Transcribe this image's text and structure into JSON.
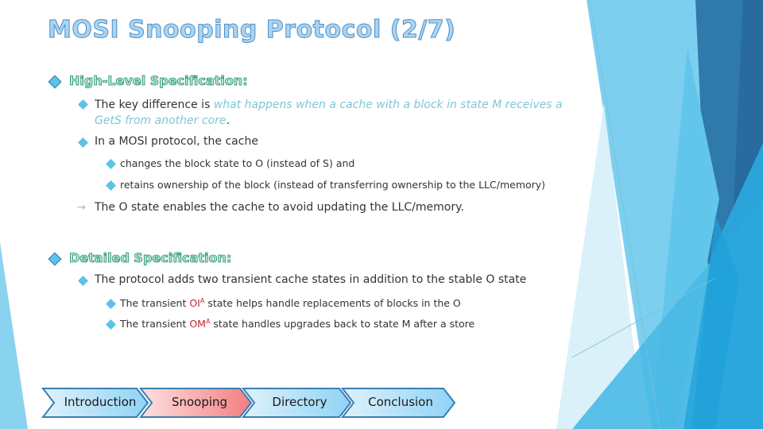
{
  "slide": {
    "title": "MOSI Snooping Protocol (2/7)",
    "accent_colors": {
      "title_fill": "#a9d4f2",
      "section_heading": "#1f8a66",
      "emphasis_text": "#7fc6d6",
      "state_red": "#c0262a",
      "bullet": "#5cc3e6",
      "nav_active": "#f58a8a",
      "nav_inactive": "#a9dcf5"
    }
  },
  "sections": [
    {
      "heading": "High-Level Specification:",
      "bullets": [
        {
          "prefix": "The key difference is ",
          "emphasis_line1": "what happens when a cache with a block in state M receives a",
          "emphasis_line2": "GetS from another core",
          "suffix": "."
        },
        {
          "text": "In a MOSI protocol, the cache",
          "sub": [
            {
              "text": "changes the block state to O (instead of S) and"
            },
            {
              "text": "retains ownership of the block (instead of transferring ownership to the LLC/memory)"
            }
          ]
        }
      ],
      "note": {
        "icon": "arrow-right-icon",
        "text": "The O state enables the cache to avoid updating the LLC/memory."
      }
    },
    {
      "heading": "Detailed Specification:",
      "bullets": [
        {
          "text": "The protocol adds two transient cache states in addition to the stable O state",
          "sub": [
            {
              "pre": "The transient ",
              "state": "OI",
              "sup": "A",
              "post": " state helps handle replacements of blocks in the O"
            },
            {
              "pre": "The transient ",
              "state": "OM",
              "sup": "A",
              "post": " state handles upgrades back to state M after a store"
            }
          ]
        }
      ]
    }
  ],
  "nav": {
    "items": [
      {
        "label": "Introduction",
        "active": false
      },
      {
        "label": "Snooping",
        "active": true
      },
      {
        "label": "Directory",
        "active": false
      },
      {
        "label": "Conclusion",
        "active": false
      }
    ]
  }
}
